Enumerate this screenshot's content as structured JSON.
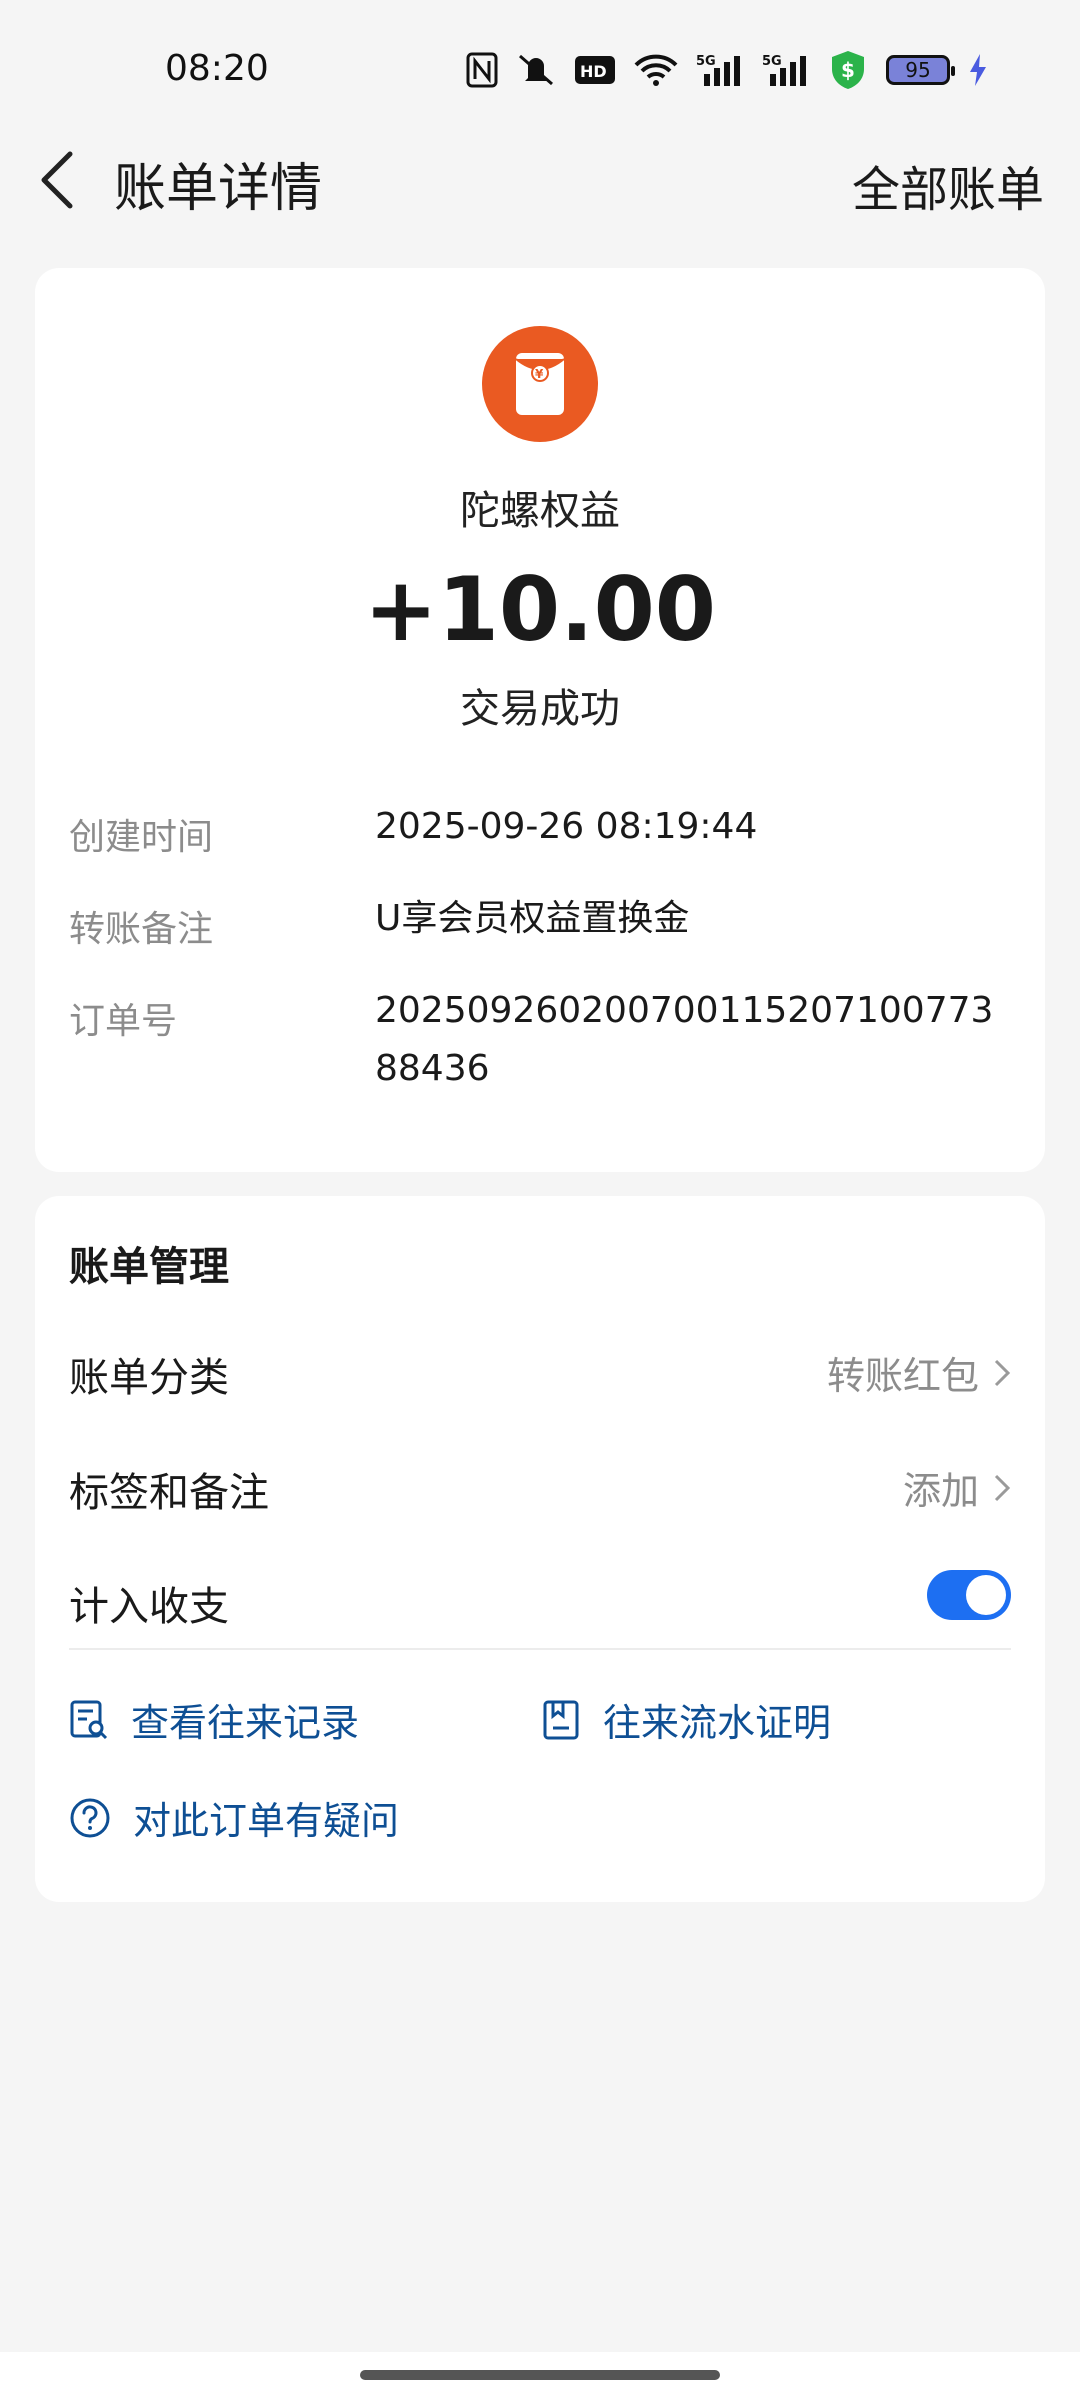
{
  "status_bar": {
    "time": "08:20",
    "icons": [
      "nfc-icon",
      "mute-icon",
      "hd-icon",
      "wifi-icon",
      "signal-5g-icon",
      "signal-5g-icon",
      "shield-dollar-icon",
      "battery-icon",
      "charging-icon"
    ],
    "battery_level": "95"
  },
  "header": {
    "title": "账单详情",
    "all_bills": "全部账单"
  },
  "transaction": {
    "merchant": "陀螺权益",
    "amount": "+10.00",
    "status": "交易成功",
    "icon": "red-packet-icon",
    "icon_color": "#ea5a22"
  },
  "details": [
    {
      "label": "创建时间",
      "value": "2025-09-26 08:19:44"
    },
    {
      "label": "转账备注",
      "value": "U享会员权益置换金"
    },
    {
      "label": "订单号",
      "value": "20250926020070011520710077388436"
    }
  ],
  "manage": {
    "title": "账单管理",
    "category_label": "账单分类",
    "category_value": "转账红包",
    "tag_label": "标签和备注",
    "tag_value": "添加",
    "include_label": "计入收支",
    "include_on": true,
    "links": {
      "records": "查看往来记录",
      "proof": "往来流水证明",
      "question": "对此订单有疑问"
    }
  },
  "colors": {
    "accent": "#1d6ff2",
    "link": "#0e4f94",
    "muted": "#8c8c8c"
  }
}
